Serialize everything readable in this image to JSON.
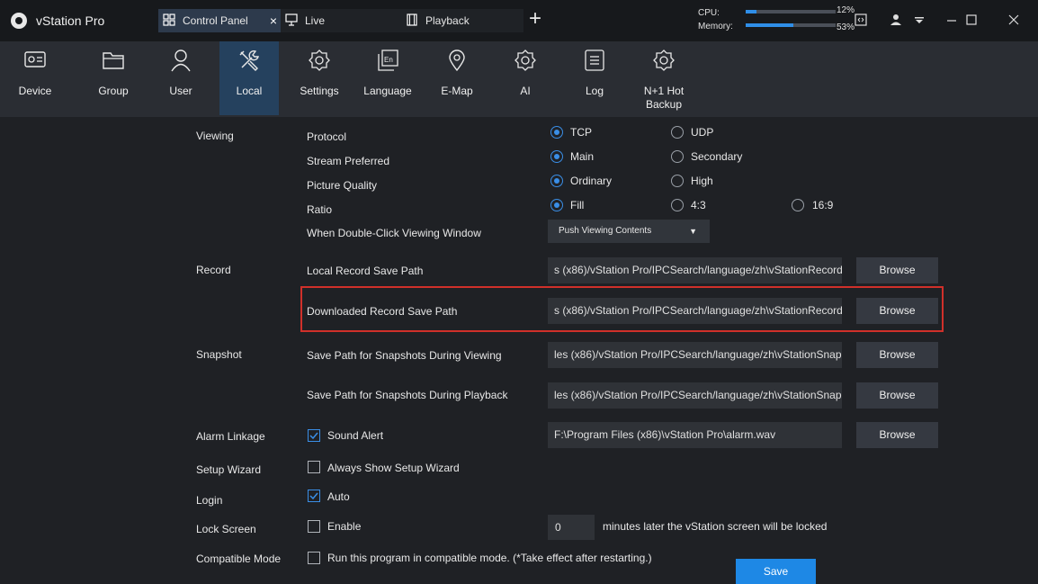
{
  "app": {
    "title": "vStation Pro"
  },
  "tabs": [
    {
      "label": "Control Panel",
      "close": "×"
    },
    {
      "label": "Live"
    },
    {
      "label": "Playback"
    }
  ],
  "add_tab": "+",
  "system": {
    "cpu_label": "CPU:",
    "cpu_value": "12%",
    "cpu_level": 0.12,
    "memory_label": "Memory:",
    "memory_value": "53%",
    "memory_level": 0.53
  },
  "window_controls": [
    "fullscreen-icon",
    "user-icon",
    "menu-dropdown-icon",
    "minimize-icon",
    "maximize-icon",
    "close-icon"
  ],
  "toolbar": [
    {
      "label": "Device",
      "icon": "device-icon"
    },
    {
      "label": "Group",
      "icon": "folder-icon"
    },
    {
      "label": "User",
      "icon": "user-icon"
    },
    {
      "label": "Local",
      "icon": "tools-icon",
      "active": true
    },
    {
      "label": "Settings",
      "icon": "gear-icon"
    },
    {
      "label": "Language",
      "icon": "language-icon"
    },
    {
      "label": "E-Map",
      "icon": "map-pin-icon"
    },
    {
      "label": "AI",
      "icon": "ai-gear-icon"
    },
    {
      "label": "Log",
      "icon": "log-icon"
    },
    {
      "label": "N+1 Hot\nBackup",
      "icon": "backup-gear-icon"
    }
  ],
  "viewing": {
    "section": "Viewing",
    "protocol": {
      "label": "Protocol",
      "options": [
        "TCP",
        "UDP"
      ],
      "selected": "TCP"
    },
    "stream": {
      "label": "Stream Preferred",
      "options": [
        "Main",
        "Secondary"
      ],
      "selected": "Main"
    },
    "quality": {
      "label": "Picture Quality",
      "options": [
        "Ordinary",
        "High"
      ],
      "selected": "Ordinary"
    },
    "ratio": {
      "label": "Ratio",
      "options": [
        "Fill",
        "4:3",
        "16:9"
      ],
      "selected": "Fill"
    },
    "double_click": {
      "label": "When Double-Click Viewing Window",
      "value": "Push Viewing Contents"
    }
  },
  "record": {
    "section": "Record",
    "local": {
      "label": "Local Record Save Path",
      "value": "s (x86)/vStation Pro/IPCSearch/language/zh\\vStationRecord",
      "button": "Browse"
    },
    "downloaded": {
      "label": "Downloaded Record Save Path",
      "value": "s (x86)/vStation Pro/IPCSearch/language/zh\\vStationRecord",
      "button": "Browse"
    }
  },
  "snapshot": {
    "section": "Snapshot",
    "viewing": {
      "label": "Save Path for Snapshots During Viewing",
      "value": "les (x86)/vStation Pro/IPCSearch/language/zh\\vStationSnap",
      "button": "Browse"
    },
    "playback": {
      "label": "Save Path for Snapshots During Playback",
      "value": "les (x86)/vStation Pro/IPCSearch/language/zh\\vStationSnap",
      "button": "Browse"
    }
  },
  "alarm": {
    "section": "Alarm Linkage",
    "sound_label": "Sound Alert",
    "sound_checked": true,
    "value": "F:\\Program Files (x86)\\vStation Pro\\alarm.wav",
    "button": "Browse"
  },
  "setup_wizard": {
    "section": "Setup Wizard",
    "label": "Always Show Setup Wizard",
    "checked": false
  },
  "login": {
    "section": "Login",
    "label": "Auto",
    "checked": true
  },
  "lock_screen": {
    "section": "Lock Screen",
    "label": "Enable",
    "checked": false,
    "minutes": "0",
    "suffix": "minutes later the vStation screen will be locked"
  },
  "compatible": {
    "section": "Compatible Mode",
    "label": "Run this program in compatible mode. (*Take effect after restarting.)",
    "checked": false
  },
  "save_label": "Save",
  "colors": {
    "accent": "#1e88e5",
    "highlight": "#d0302a",
    "active_tool": "#25415e"
  }
}
